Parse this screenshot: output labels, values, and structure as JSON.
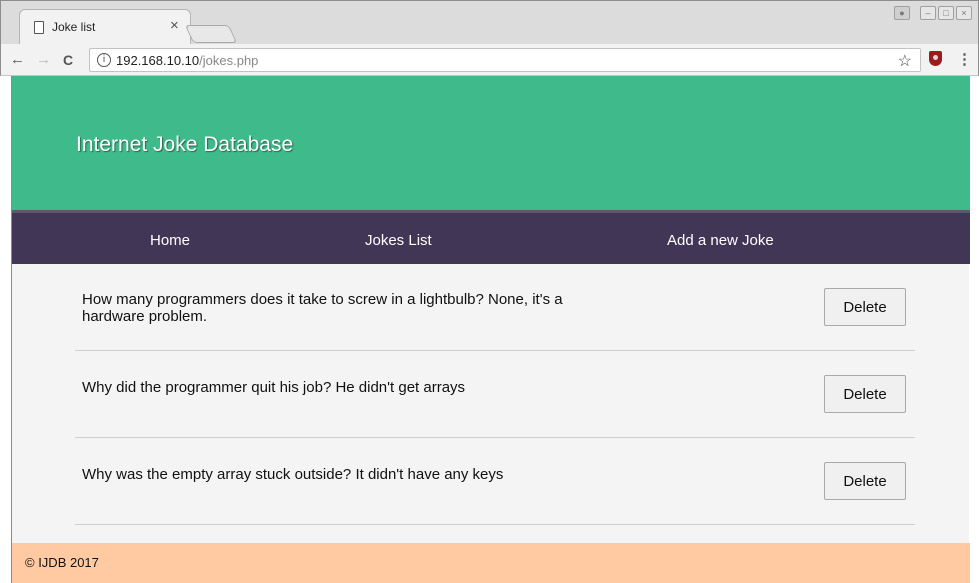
{
  "browser": {
    "tab_title": "Joke list",
    "tab_close": "×",
    "url_host": "192.168.10.10",
    "url_path": "/jokes.php",
    "back_glyph": "←",
    "forward_glyph": "→",
    "reload_glyph": "C",
    "info_glyph": "i",
    "star_glyph": "☆",
    "menu_glyph": "⋮",
    "window_buttons": [
      "–",
      "□",
      "×"
    ]
  },
  "site": {
    "title": "Internet Joke Database",
    "nav": {
      "home": "Home",
      "jokes_list": "Jokes List",
      "add_joke": "Add a new Joke"
    },
    "jokes": [
      {
        "text": "How many programmers does it take to screw in a lightbulb? None, it's a hardware problem.",
        "button": "Delete"
      },
      {
        "text": "Why did the programmer quit his job? He didn't get arrays",
        "button": "Delete"
      },
      {
        "text": "Why was the empty array stuck outside? It didn't have any keys",
        "button": "Delete"
      }
    ],
    "footer": "© IJDB 2017"
  },
  "colors": {
    "banner": "#3fba8b",
    "navbar": "#423656",
    "footer": "#ffcaa2",
    "content_bg": "#f4f4f4"
  }
}
